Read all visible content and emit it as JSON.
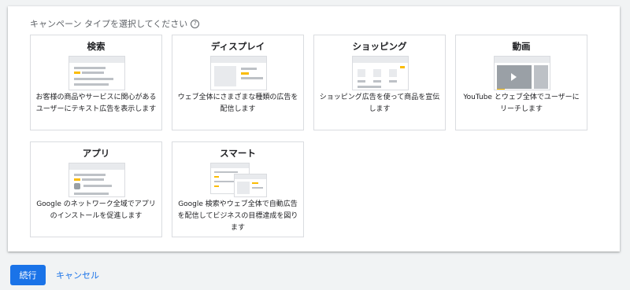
{
  "heading": "キャンペーン タイプを選択してください",
  "help_icon": "?",
  "cards": [
    {
      "title": "検索",
      "desc": "お客様の商品やサービスに関心があるユーザーにテキスト広告を表示します"
    },
    {
      "title": "ディスプレイ",
      "desc": "ウェブ全体にさまざまな種類の広告を配信します"
    },
    {
      "title": "ショッピング",
      "desc": "ショッピング広告を使って商品を宣伝します"
    },
    {
      "title": "動画",
      "desc": "YouTube とウェブ全体でユーザーにリーチします"
    },
    {
      "title": "アプリ",
      "desc": "Google のネットワーク全域でアプリのインストールを促進します"
    },
    {
      "title": "スマート",
      "desc": "Google 検索やウェブ全体で自動広告を配信してビジネスの目標達成を図ります"
    }
  ],
  "buttons": {
    "continue": "続行",
    "cancel": "キャンセル"
  },
  "colors": {
    "accent": "#1a73e8",
    "highlight": "#fbbc04",
    "background": "#f1f3f4"
  }
}
